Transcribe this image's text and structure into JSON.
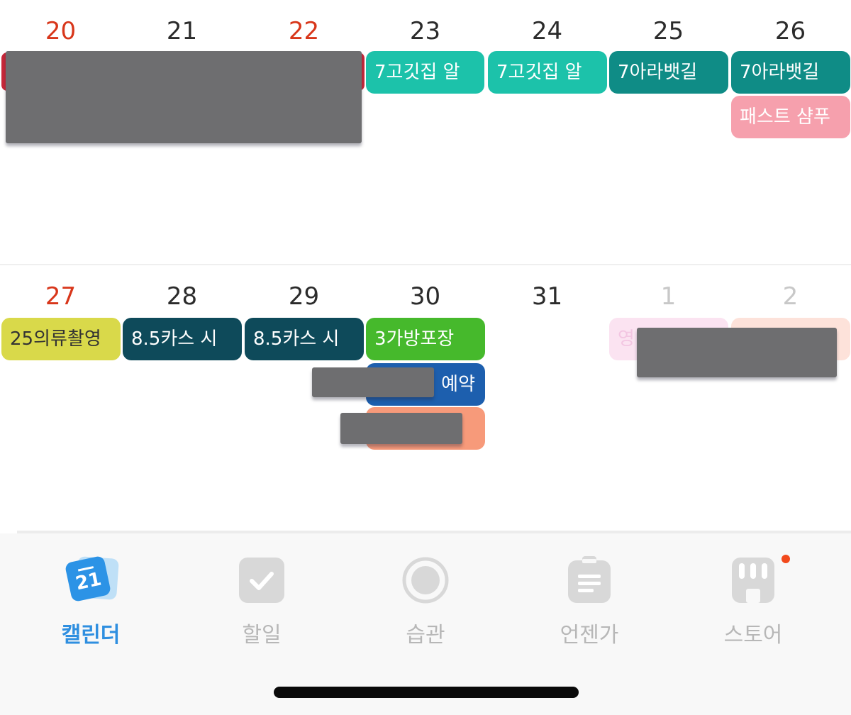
{
  "colors": {
    "sunday": "#d8361a",
    "teal": "#1cc2aa",
    "dark_teal": "#0f8c86",
    "pink": "#f6a0ad",
    "olive": "#d9d94a",
    "navy": "#0e4a5a",
    "green": "#46b92c",
    "blue": "#1d5fae",
    "salmon": "#f79a7a",
    "active_tab": "#2f8fe0",
    "inactive_tab": "#b7b7b7"
  },
  "weeks": [
    {
      "days": [
        {
          "label": "20",
          "holiday": true
        },
        {
          "label": "21",
          "holiday": false
        },
        {
          "label": "22",
          "holiday": true
        },
        {
          "label": "23",
          "holiday": false
        },
        {
          "label": "24",
          "holiday": false
        },
        {
          "label": "25",
          "holiday": false
        },
        {
          "label": "26",
          "holiday": false
        }
      ],
      "events": [
        {
          "day": "23",
          "title": "7고깃집 알",
          "color": "teal"
        },
        {
          "day": "24",
          "title": "7고깃집 알",
          "color": "teal"
        },
        {
          "day": "25",
          "title": "7아라뱃길",
          "color": "dark_teal"
        },
        {
          "day": "26",
          "title": "7아라뱃길",
          "color": "dark_teal"
        },
        {
          "day": "26",
          "title": "패스트 샴푸",
          "color": "pink"
        }
      ]
    },
    {
      "days": [
        {
          "label": "27",
          "holiday": true
        },
        {
          "label": "28",
          "holiday": false
        },
        {
          "label": "29",
          "holiday": false
        },
        {
          "label": "30",
          "holiday": false
        },
        {
          "label": "31",
          "holiday": false
        },
        {
          "label": "1",
          "holiday": false,
          "other_month": true
        },
        {
          "label": "2",
          "holiday": false,
          "other_month": true
        }
      ],
      "events": [
        {
          "day": "27",
          "title": "25의류촬영",
          "color": "olive"
        },
        {
          "day": "28",
          "title": "8.5카스 시",
          "color": "navy"
        },
        {
          "day": "29",
          "title": "8.5카스 시",
          "color": "navy"
        },
        {
          "day": "30",
          "title": "3가방포장",
          "color": "green"
        },
        {
          "day": "30",
          "title": "예약",
          "color": "blue"
        },
        {
          "day": "1",
          "title": "영",
          "color": "light_pink"
        }
      ]
    }
  ],
  "tabs": [
    {
      "label": "캘린더",
      "icon": "calendar-icon",
      "icon_text": "21",
      "active": true
    },
    {
      "label": "할일",
      "icon": "checkbox-icon",
      "active": false
    },
    {
      "label": "습관",
      "icon": "habit-circle-icon",
      "active": false
    },
    {
      "label": "언젠가",
      "icon": "clipboard-icon",
      "active": false
    },
    {
      "label": "스토어",
      "icon": "store-icon",
      "active": false,
      "has_badge": true
    }
  ]
}
